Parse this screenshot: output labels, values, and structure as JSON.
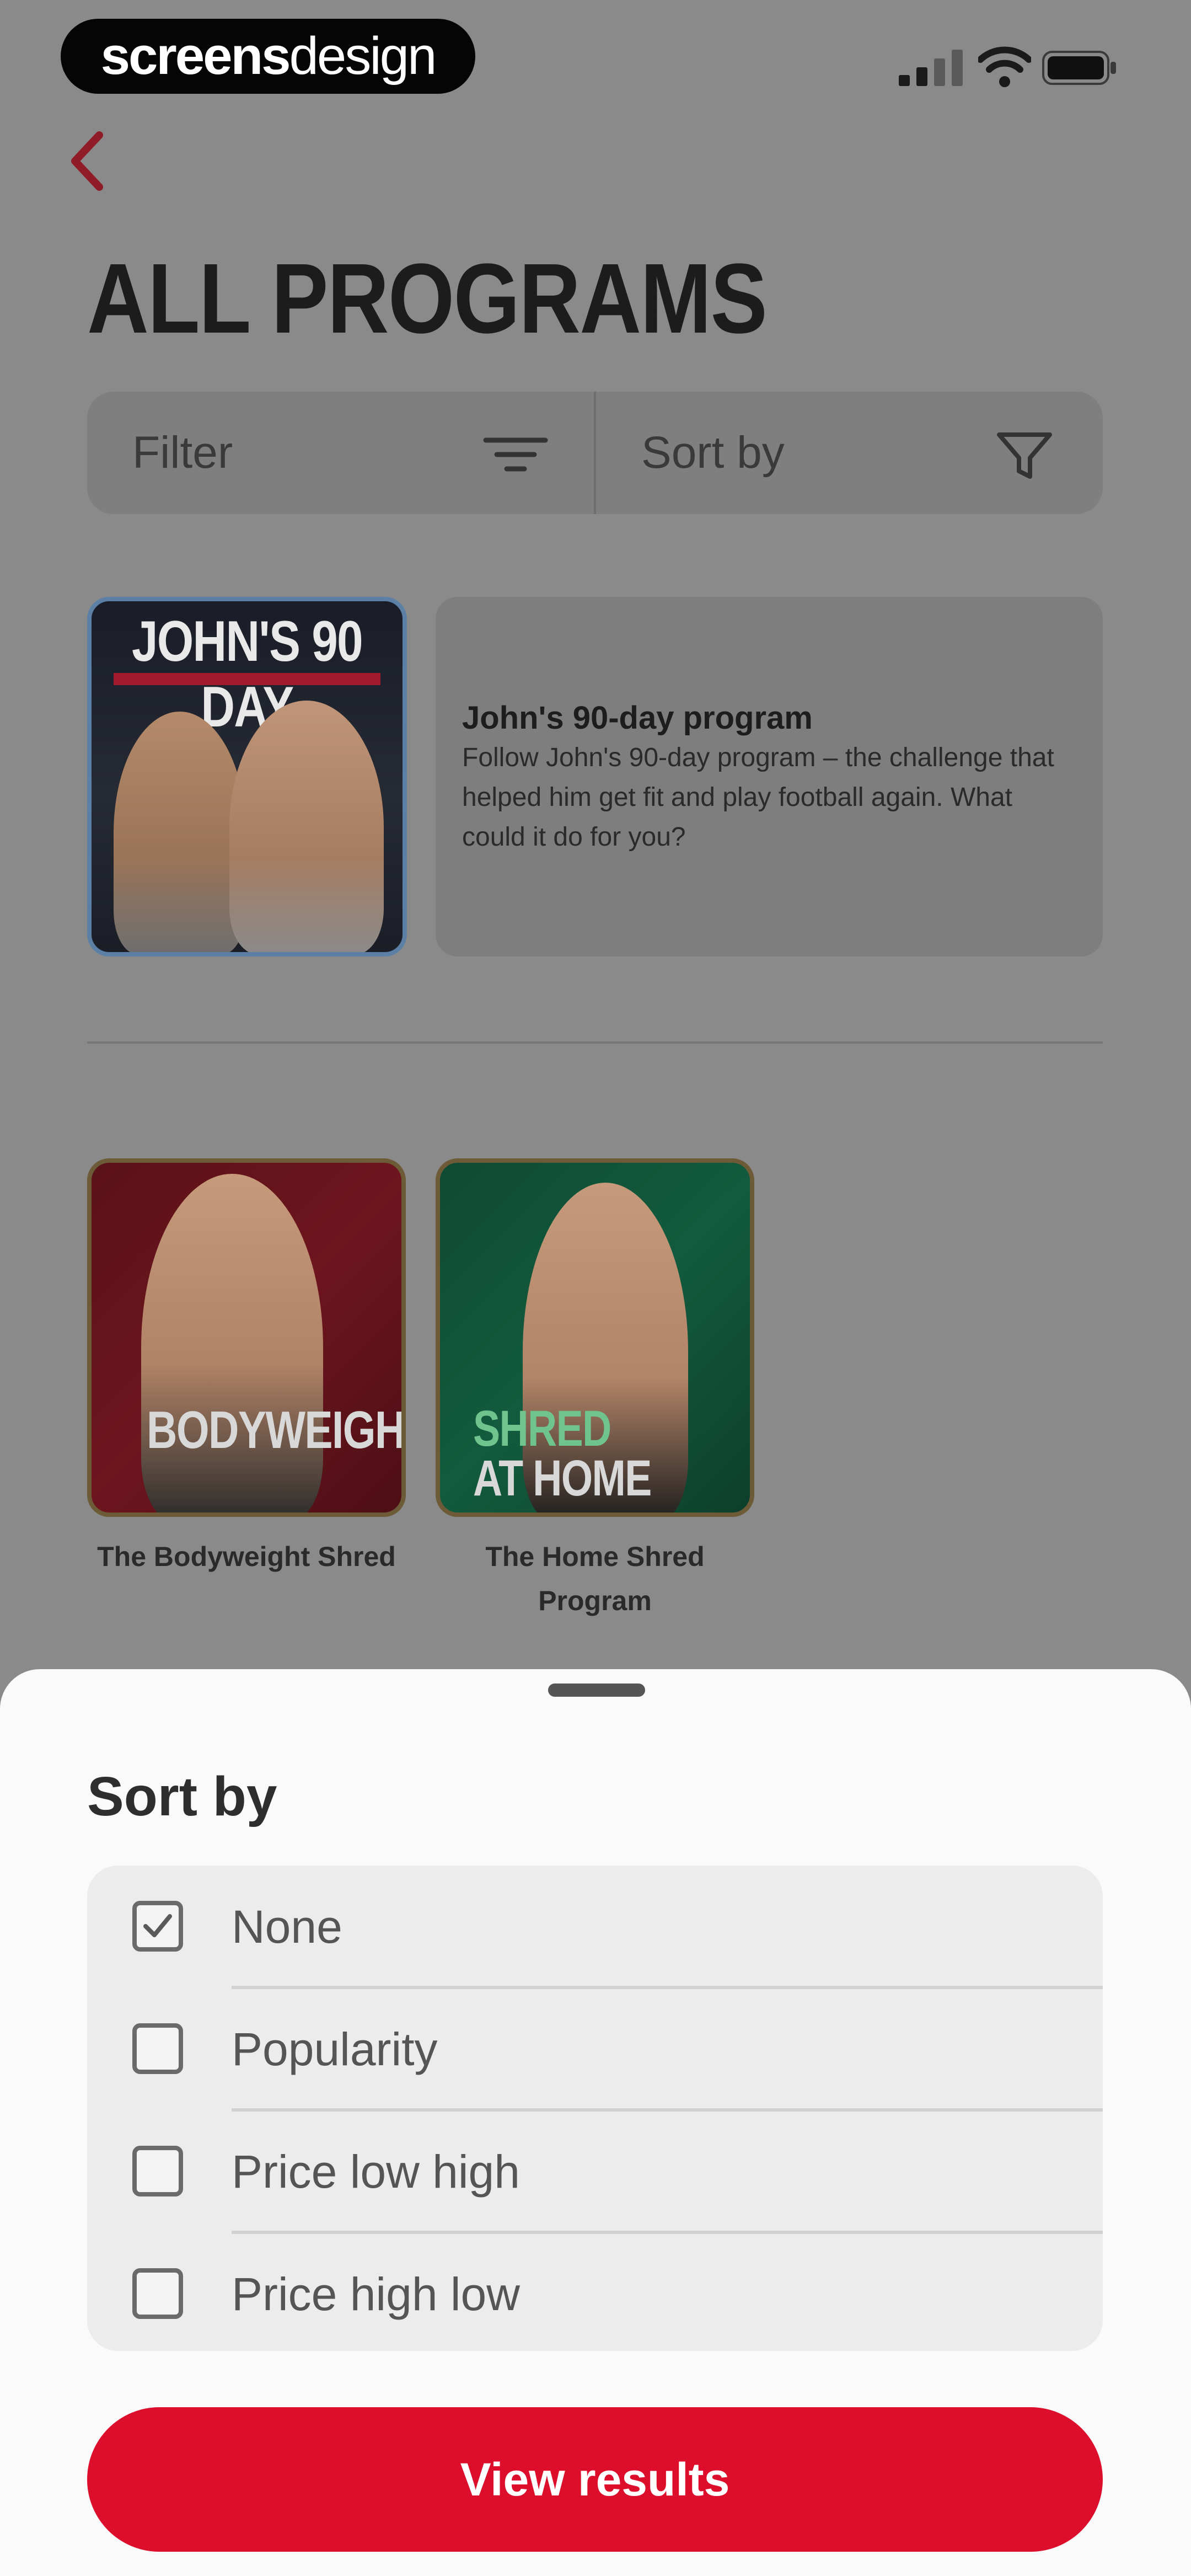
{
  "status_bar": {
    "brand_bold": "screens",
    "brand_light": "design",
    "icons": [
      "signal-icon",
      "wifi-icon",
      "battery-icon"
    ]
  },
  "header": {
    "back_icon": "chevron-left-icon",
    "title": "ALL PROGRAMS"
  },
  "toolbar": {
    "filter_label": "Filter",
    "filter_icon": "filter-lines-icon",
    "sort_label": "Sort by",
    "sort_icon": "funnel-icon"
  },
  "featured": {
    "cover_title": "JOHN'S 90 DAY",
    "name": "John's 90-day program",
    "description": "Follow John's 90-day program – the challenge that helped him get fit and play football again. What could it do for you?"
  },
  "programs": [
    {
      "cover_text": "BODYWEIGHT",
      "caption": "The Bodyweight Shred"
    },
    {
      "cover_text_1": "SHRED",
      "cover_text_2": "AT HOME",
      "caption": "The Home Shred Program"
    }
  ],
  "sort_sheet": {
    "title": "Sort by",
    "options": [
      {
        "label": "None",
        "checked": true
      },
      {
        "label": "Popularity",
        "checked": false
      },
      {
        "label": "Price low high",
        "checked": false
      },
      {
        "label": "Price high low",
        "checked": false
      }
    ],
    "cta": "View results"
  },
  "colors": {
    "accent": "#dc0e2c",
    "back_arrow": "#8f1c26",
    "overlay": "#8a8a8a",
    "sheet": "#fafafa"
  }
}
